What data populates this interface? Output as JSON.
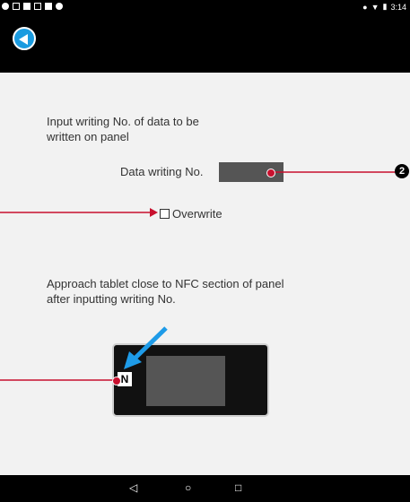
{
  "status_bar": {
    "time": "3:14"
  },
  "instruction1": {
    "line1": "Input writing No. of data to be",
    "line2": "written on panel"
  },
  "data_writing": {
    "label": "Data writing No.",
    "value": ""
  },
  "overwrite": {
    "label": "Overwrite",
    "checked": false
  },
  "instruction2": {
    "line1": "Approach tablet close to NFC section of panel",
    "line2": "after inputting writing No."
  },
  "panel": {
    "nfc_mark": "N"
  },
  "callout": {
    "number": "2"
  },
  "colors": {
    "accent": "#1a9be0",
    "callout_red": "#c8102e",
    "pointer_blue": "#1e9be8"
  },
  "nav_icons": [
    "back-icon",
    "home-icon",
    "recents-icon"
  ]
}
